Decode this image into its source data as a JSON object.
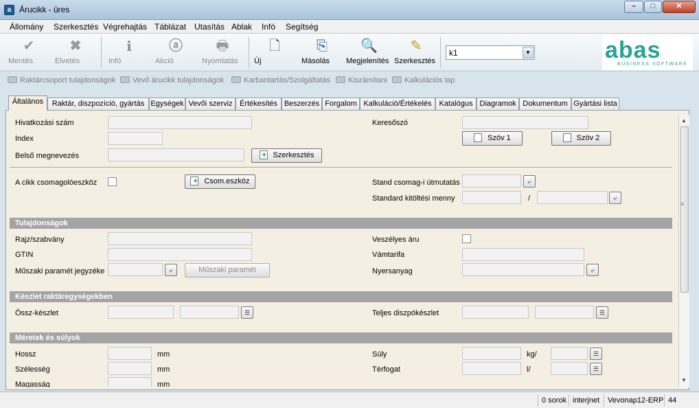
{
  "window": {
    "title": "Árucikk - üres"
  },
  "menu": [
    "Állomány",
    "Szerkesztés",
    "Végrehajtás",
    "Táblázat",
    "Utasítás",
    "Ablak",
    "Infó",
    "Segítség"
  ],
  "toolbar": {
    "mentes": "Mentés",
    "elvetes": "Elvetés",
    "info": "Infó",
    "akcio": "Akció",
    "nyomtatas": "Nyomtatás",
    "uj": "Új",
    "masolas": "Másolás",
    "megjelenites": "Megjelenítés",
    "szerkesztes": "Szerkesztés",
    "combo_value": "k1"
  },
  "logo": {
    "word": "abas",
    "sub": "BUSINESS SOFTWARE"
  },
  "links": [
    "Raktárcsoport tulajdonságok",
    "Vevő árucikk tulajdonságok",
    "Karbantartás/Szolgáltatás",
    "Kiszámítani",
    "Kalkulációs lap"
  ],
  "tabs": [
    "Általános",
    "Raktár, diszpozíció, gyártás",
    "Egységek",
    "Vevői szerviz",
    "Értékesítés",
    "Beszerzés",
    "Forgalom",
    "Kalkuláció/Értékelés",
    "Katalógus",
    "Diagramok",
    "Dokumentum",
    "Gyártási lista"
  ],
  "form": {
    "hivatkozasi_szam": "Hivatkozási szám",
    "index": "Index",
    "belso_megnevezes": "Belső megnevezés",
    "szerkesztes_btn": "Szerkesztés",
    "keresoszo": "Keresőszó",
    "szov1": "Szöv 1",
    "szov2": "Szöv 2",
    "csomagoloeszkoz": "A cikk csomagolóeszköz",
    "csom_btn": "Csom.eszköz",
    "stand_csomag": "Stand csomag-i útmutatás",
    "standard_kitoltesi": "Standard kitöltési menny",
    "slash": "/"
  },
  "sections": {
    "tulajdonsagok": "Tulajdonságok",
    "keszlet": "Készlet raktáregységekben",
    "meretek": "Méretek és súlyok"
  },
  "tulaj": {
    "rajz": "Rajz/szabvány",
    "gtin": "GTIN",
    "muszaki_jegyzek": "Műszaki paramét jegyzéke",
    "muszaki_btn": "Műszaki paramét",
    "veszelyes": "Veszélyes áru",
    "vamtarifa": "Vámtarifa",
    "nyersanyag": "Nyersanyag"
  },
  "keszlet": {
    "ossz": "Össz-készlet",
    "teljes": "Teljes diszpókészlet"
  },
  "meretek": {
    "hossz": "Hossz",
    "szelesseg": "Szélesség",
    "magassag": "Magasság",
    "unit_mm": "mm",
    "suly": "Súly",
    "terfogat": "Térfogat",
    "unit_kg": "kg/",
    "unit_l": "l/"
  },
  "status": {
    "sorok": "0 sorok",
    "net": "interjnet",
    "vevonap": "Vevonap12-ERP",
    "num": "44"
  }
}
